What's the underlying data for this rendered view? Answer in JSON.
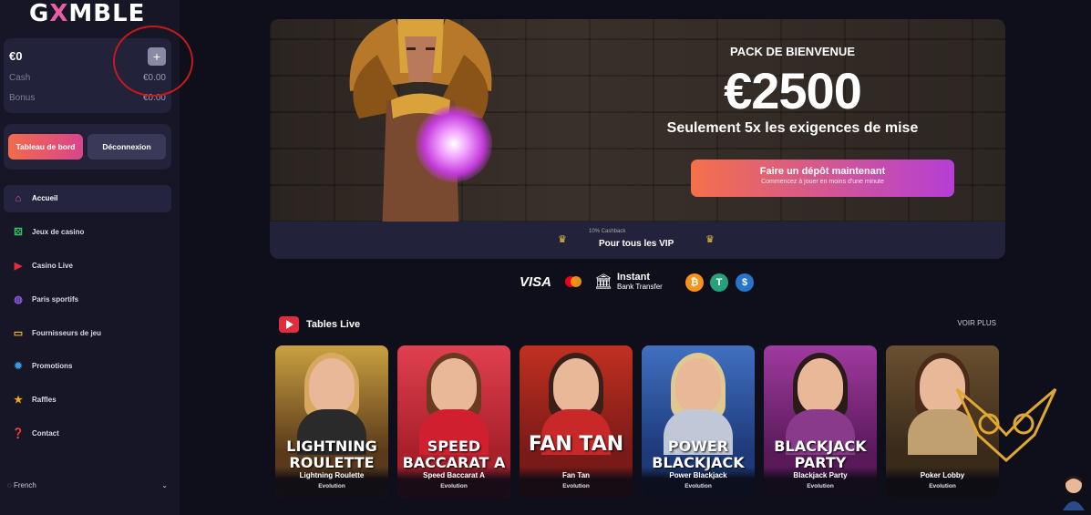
{
  "brand": {
    "logo_left": "G",
    "logo_x": "X",
    "logo_right": "MBLE"
  },
  "wallet": {
    "balance": "€0",
    "add_symbol": "+",
    "cash_label": "Cash",
    "cash_value": "€0.00",
    "bonus_label": "Bonus",
    "bonus_value": "€0.00"
  },
  "auth": {
    "dashboard": "Tableau de bord",
    "logout": "Déconnexion"
  },
  "nav": {
    "items": [
      {
        "label": "Accueil",
        "icon": "home-icon",
        "active": true
      },
      {
        "label": "Jeux de casino",
        "icon": "dice-icon"
      },
      {
        "label": "Casino Live",
        "icon": "live-icon"
      },
      {
        "label": "Paris sportifs",
        "icon": "basketball-icon"
      },
      {
        "label": "Fournisseurs de jeu",
        "icon": "gamepad-icon"
      },
      {
        "label": "Promotions",
        "icon": "badge-icon"
      },
      {
        "label": "Raffles",
        "icon": "star-icon"
      },
      {
        "label": "Contact",
        "icon": "help-icon"
      }
    ]
  },
  "language": {
    "current": "French",
    "chevron": "⌄"
  },
  "hero": {
    "pack_title": "PACK DE BIENVENUE",
    "amount": "€2500",
    "subline": "Seulement 5x les exigences de mise",
    "deposit_main": "Faire un dépôt maintenant",
    "deposit_sub": "Commencez à jouer en moins d'une minute",
    "cashback": "10% Cashback",
    "vip": "Pour tous les VIP",
    "crown": "♛"
  },
  "payments": {
    "visa": "VISA",
    "instant": "Instant",
    "bank_transfer": "Bank Transfer",
    "btc": "₿",
    "usdt": "T",
    "usdc": "$"
  },
  "live": {
    "title": "Tables Live",
    "see_more": "VOIR PLUS",
    "tables": [
      {
        "logo": "LIGHTNING ROULETTE",
        "name": "Lightning Roulette",
        "provider": "Evolution",
        "bg": "#5a3a1a",
        "accent": "#c9a040",
        "hair": "#d9a860",
        "dress": "#2a2a2a"
      },
      {
        "logo": "SPEED BACCARAT A",
        "name": "Speed Baccarat A",
        "provider": "Evolution",
        "bg": "#a8202a",
        "accent": "#e04050",
        "hair": "#6a3a20",
        "dress": "#d02030"
      },
      {
        "logo": "FAN TAN",
        "name": "Fan Tan",
        "provider": "Evolution",
        "bg": "#7a1a18",
        "accent": "#c03020",
        "hair": "#3a2018",
        "dress": "#c82828"
      },
      {
        "logo": "POWER BLACKJACK",
        "name": "Power Blackjack",
        "provider": "Evolution",
        "bg": "#1e3a7a",
        "accent": "#4070c0",
        "hair": "#e0c890",
        "dress": "#c0c8d8"
      },
      {
        "logo": "BLACKJACK PARTY",
        "name": "Blackjack Party",
        "provider": "Evolution",
        "bg": "#5a1a5a",
        "accent": "#a03aa0",
        "hair": "#2a1a18",
        "dress": "#8a3a8a"
      },
      {
        "logo": "",
        "name": "Poker Lobby",
        "provider": "Evolution",
        "bg": "#3a2a1a",
        "accent": "#6a5030",
        "hair": "#4a2a18",
        "dress": "#c0a070"
      }
    ]
  },
  "colors": {
    "annotation": "#c51a1a",
    "brand_pink": "#e85ea0",
    "cta_start": "#f4704a",
    "cta_end": "#b53fd6"
  }
}
